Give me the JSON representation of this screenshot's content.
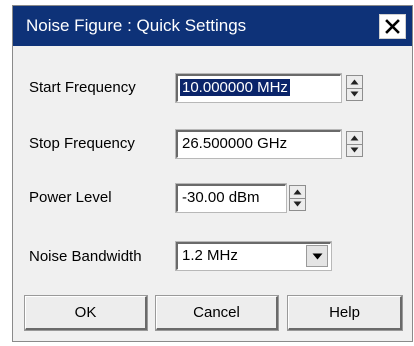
{
  "dialog": {
    "title": "Noise Figure : Quick Settings",
    "close_label": "X"
  },
  "fields": {
    "start_frequency": {
      "label": "Start Frequency",
      "value": "10.000000 MHz"
    },
    "stop_frequency": {
      "label": "Stop Frequency",
      "value": "26.500000 GHz"
    },
    "power_level": {
      "label": "Power Level",
      "value": "-30.00 dBm"
    },
    "noise_bandwidth": {
      "label": "Noise Bandwidth",
      "value": "1.2 MHz"
    }
  },
  "buttons": {
    "ok": "OK",
    "cancel": "Cancel",
    "help": "Help"
  },
  "colors": {
    "titlebar": "#0e3278",
    "selection": "#0a246a",
    "dialog_bg": "#f0f0f0"
  },
  "icons": [
    "close-icon",
    "spin-up-icon",
    "spin-down-icon",
    "chevron-down-icon"
  ]
}
